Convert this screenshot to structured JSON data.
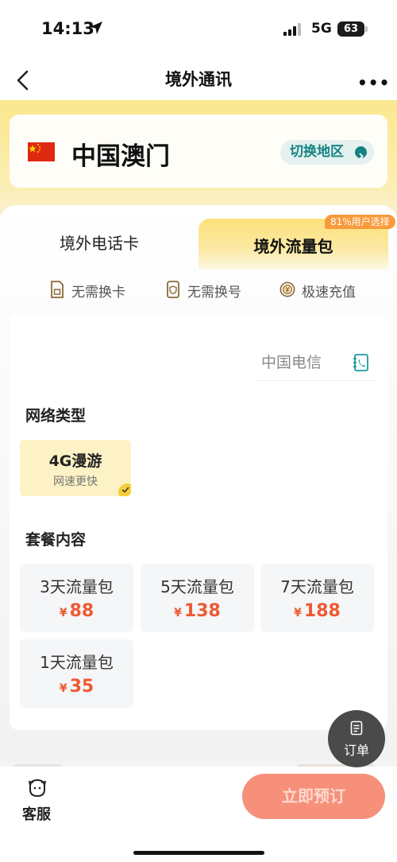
{
  "status_bar": {
    "time": "14:13",
    "network": "5G",
    "battery": "63"
  },
  "nav": {
    "title": "境外通讯",
    "more": "•••"
  },
  "region": {
    "name": "中国澳门",
    "switch_label": "切换地区"
  },
  "tabs": [
    {
      "label": "境外电话卡",
      "selected": false
    },
    {
      "label": "境外流量包",
      "selected": true,
      "badge": "81%用户选择"
    }
  ],
  "features": [
    "无需换卡",
    "无需换号",
    "极速充值"
  ],
  "carrier": {
    "name": "中国电信"
  },
  "network_type": {
    "title": "网络类型",
    "option": {
      "title": "4G漫游",
      "subtitle": "网速更快",
      "selected": true
    }
  },
  "packages": {
    "title": "套餐内容",
    "currency": "¥",
    "items": [
      {
        "name": "3天流量包",
        "price": "88"
      },
      {
        "name": "5天流量包",
        "price": "138"
      },
      {
        "name": "7天流量包",
        "price": "188"
      },
      {
        "name": "1天流量包",
        "price": "35"
      }
    ]
  },
  "fab": {
    "label": "订单"
  },
  "bottom": {
    "service_label": "客服",
    "book_label": "立即预订"
  },
  "colors": {
    "accent": "#138383",
    "price": "#ee5a32",
    "cta": "#f6907a",
    "highlight": "#fdf2c6"
  }
}
